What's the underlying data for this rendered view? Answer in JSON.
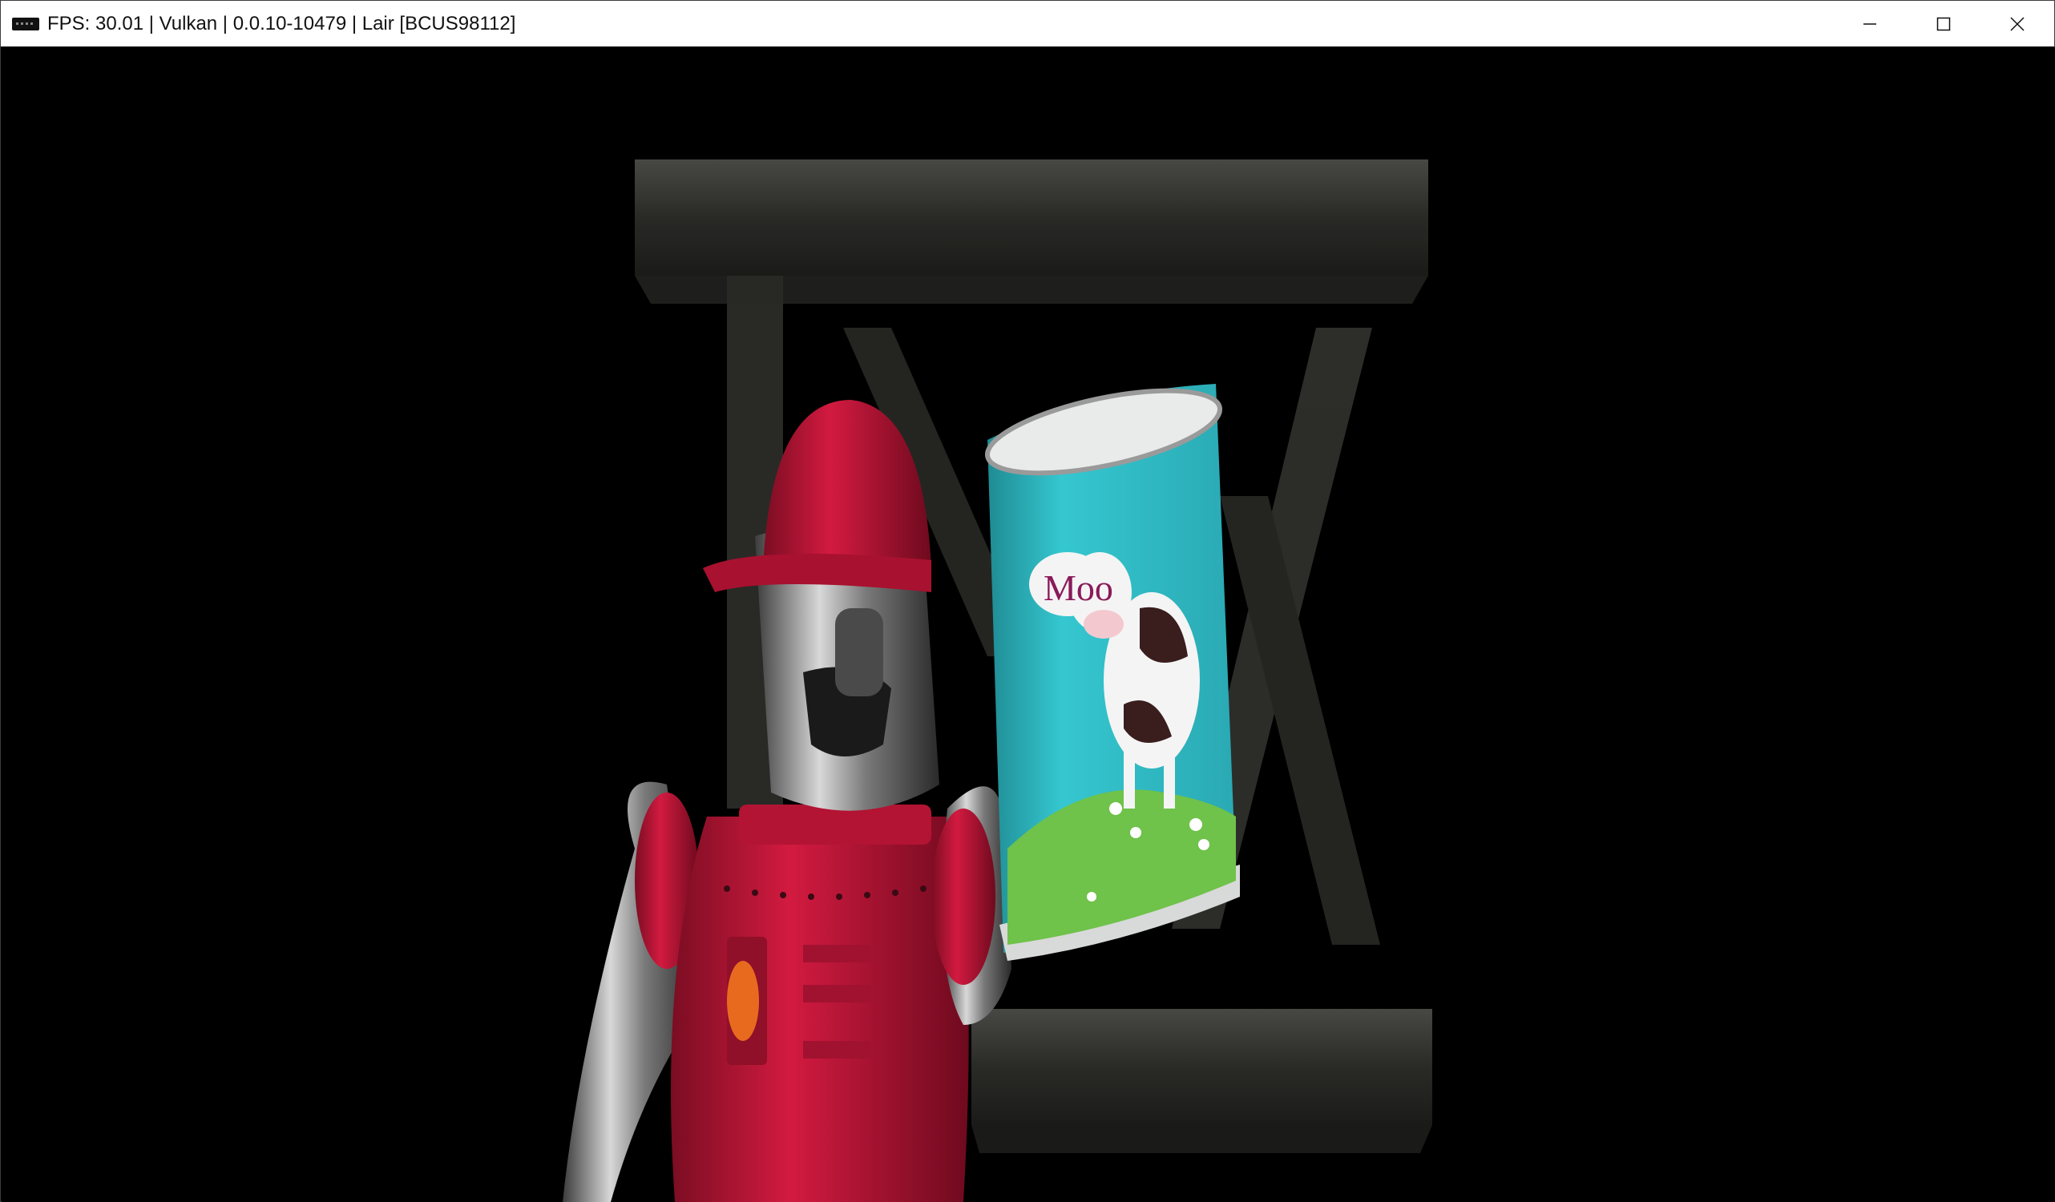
{
  "window": {
    "title": "FPS: 30.01 | Vulkan | 0.0.10-10479 | Lair [BCUS98112]",
    "controls": {
      "minimize_icon": "minimize-icon",
      "maximize_icon": "maximize-icon",
      "close_icon": "close-icon"
    }
  },
  "scene": {
    "can_label": "Moo",
    "colors": {
      "robot_red": "#c8163a",
      "can_teal": "#33c6cf",
      "grass_green": "#6fc24a",
      "logo_gray": "#3a3b36"
    }
  }
}
